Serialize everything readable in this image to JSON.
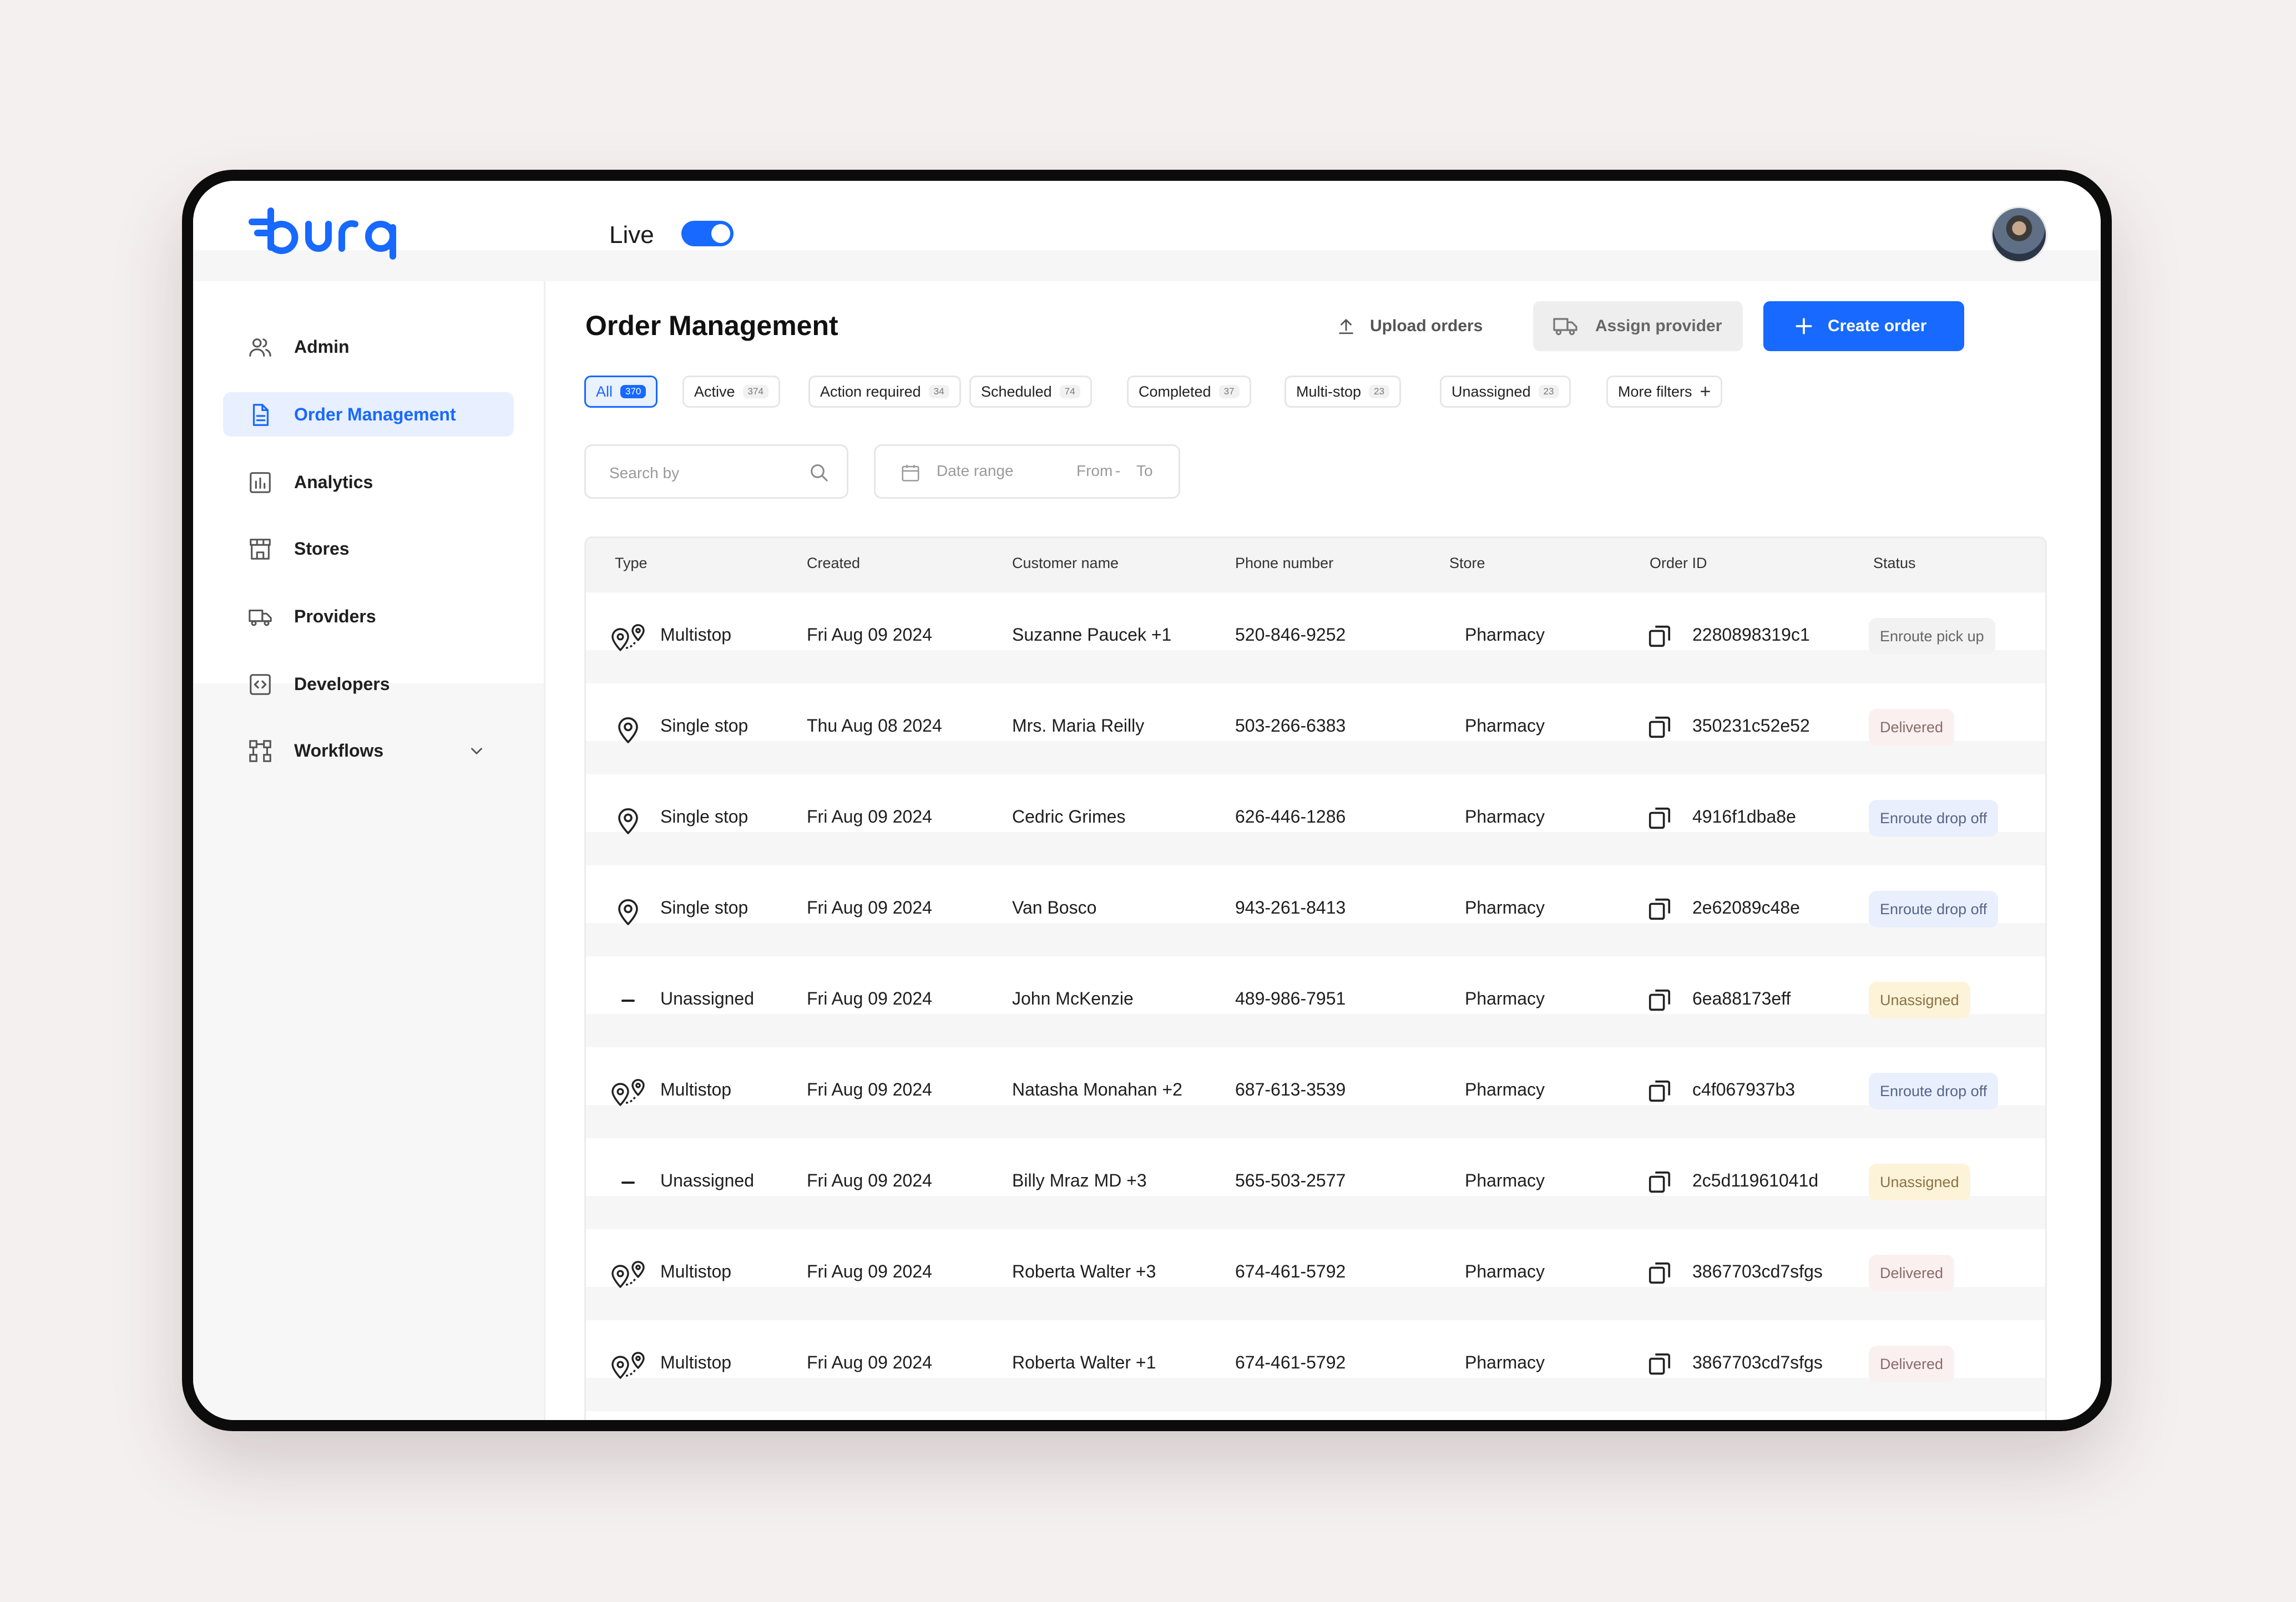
{
  "header": {
    "live_label": "Live",
    "live_on": true,
    "brand_color": "#1769ff"
  },
  "sidebar": {
    "items": [
      {
        "label": "Admin",
        "icon": "users-icon",
        "active": false
      },
      {
        "label": "Order Management",
        "icon": "document-icon",
        "active": true
      },
      {
        "label": "Analytics",
        "icon": "bar-chart-icon",
        "active": false
      },
      {
        "label": "Stores",
        "icon": "store-icon",
        "active": false
      },
      {
        "label": "Providers",
        "icon": "truck-icon",
        "active": false
      },
      {
        "label": "Developers",
        "icon": "code-icon",
        "active": false
      },
      {
        "label": "Workflows",
        "icon": "workflow-icon",
        "active": false
      }
    ]
  },
  "main": {
    "title": "Order Management",
    "upload_label": "Upload orders",
    "assign_label": "Assign provider",
    "create_label": "Create order",
    "filters": [
      {
        "label": "All",
        "count": "370",
        "active": true
      },
      {
        "label": "Active",
        "count": "374",
        "active": false
      },
      {
        "label": "Action required",
        "count": "34",
        "active": false
      },
      {
        "label": "Scheduled",
        "count": "74",
        "active": false
      },
      {
        "label": "Completed",
        "count": "37",
        "active": false
      },
      {
        "label": "Multi-stop",
        "count": "23",
        "active": false
      },
      {
        "label": "Unassigned",
        "count": "23",
        "active": false
      }
    ],
    "more_filters_label": "More filters",
    "search_placeholder": "Search by",
    "date_range_label": "Date range",
    "date_from": "From",
    "date_sep": "-",
    "date_to": "To"
  },
  "table": {
    "columns": [
      "Type",
      "Created",
      "Customer name",
      "Phone number",
      "Store",
      "Order ID",
      "Status"
    ],
    "rows": [
      {
        "type": "Multistop",
        "type_icon": "multi-pin-icon",
        "created": "Fri Aug 09 2024",
        "customer": "Suzanne Paucek +1",
        "phone": "520-846-9252",
        "store": "Pharmacy",
        "order_id": "2280898319c1",
        "status": "Enroute pick up",
        "status_kind": "pickup"
      },
      {
        "type": "Single stop",
        "type_icon": "pin-icon",
        "created": "Thu Aug 08 2024",
        "customer": "Mrs. Maria Reilly",
        "phone": "503-266-6383",
        "store": "Pharmacy",
        "order_id": "350231c52e52",
        "status": "Delivered",
        "status_kind": "delivered"
      },
      {
        "type": "Single stop",
        "type_icon": "pin-icon",
        "created": "Fri Aug 09 2024",
        "customer": "Cedric Grimes",
        "phone": "626-446-1286",
        "store": "Pharmacy",
        "order_id": "4916f1dba8e",
        "status": "Enroute drop off",
        "status_kind": "dropoff"
      },
      {
        "type": "Single stop",
        "type_icon": "pin-icon",
        "created": "Fri Aug 09 2024",
        "customer": "Van Bosco",
        "phone": "943-261-8413",
        "store": "Pharmacy",
        "order_id": "2e62089c48e",
        "status": "Enroute drop off",
        "status_kind": "dropoff"
      },
      {
        "type": "Unassigned",
        "type_icon": "dash-icon",
        "created": "Fri Aug 09 2024",
        "customer": "John McKenzie",
        "phone": "489-986-7951",
        "store": "Pharmacy",
        "order_id": "6ea88173eff",
        "status": "Unassigned",
        "status_kind": "unassigned"
      },
      {
        "type": "Multistop",
        "type_icon": "multi-pin-icon",
        "created": "Fri Aug 09 2024",
        "customer": "Natasha Monahan +2",
        "phone": "687-613-3539",
        "store": "Pharmacy",
        "order_id": "c4f067937b3",
        "status": "Enroute drop off",
        "status_kind": "dropoff"
      },
      {
        "type": "Unassigned",
        "type_icon": "dash-icon",
        "created": "Fri Aug 09 2024",
        "customer": "Billy Mraz MD +3",
        "phone": "565-503-2577",
        "store": "Pharmacy",
        "order_id": "2c5d11961041d",
        "status": "Unassigned",
        "status_kind": "unassigned"
      },
      {
        "type": "Multistop",
        "type_icon": "multi-pin-icon",
        "created": "Fri Aug 09 2024",
        "customer": "Roberta Walter +3",
        "phone": "674-461-5792",
        "store": "Pharmacy",
        "order_id": "3867703cd7sfgs",
        "status": "Delivered",
        "status_kind": "delivered"
      },
      {
        "type": "Multistop",
        "type_icon": "multi-pin-icon",
        "created": "Fri Aug 09 2024",
        "customer": "Roberta Walter +1",
        "phone": "674-461-5792",
        "store": "Pharmacy",
        "order_id": "3867703cd7sfgs",
        "status": "Delivered",
        "status_kind": "delivered"
      }
    ]
  }
}
